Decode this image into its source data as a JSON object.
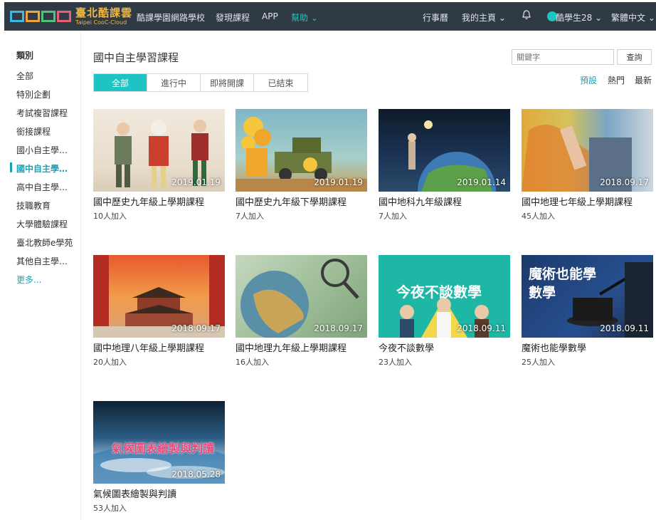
{
  "header": {
    "logo_cn": "臺北酷課雲",
    "logo_en": "Taipei CooC-Cloud",
    "nav": [
      {
        "label": "酷課學園網路學校"
      },
      {
        "label": "發現課程"
      },
      {
        "label": "APP"
      },
      {
        "label": "幫助 ⌄"
      }
    ],
    "right_nav": [
      {
        "label": "行事曆"
      },
      {
        "label": "我的主頁 ⌄"
      },
      {
        "label": "酷學生28 ⌄"
      },
      {
        "label": "繁體中文 ⌄"
      }
    ],
    "accent": "#1ec3c3",
    "bar_color": "#2f3a44"
  },
  "sidebar": {
    "heading": "類別",
    "items": [
      {
        "label": "全部"
      },
      {
        "label": "特別企劃"
      },
      {
        "label": "考試複習課程"
      },
      {
        "label": "銜接課程"
      },
      {
        "label": "國小自主學…"
      },
      {
        "label": "國中自主學…"
      },
      {
        "label": "高中自主學…"
      },
      {
        "label": "技職教育"
      },
      {
        "label": "大學體驗課程"
      },
      {
        "label": "臺北教師e學苑"
      },
      {
        "label": "其他自主學…"
      },
      {
        "label": "更多..."
      }
    ]
  },
  "main": {
    "title": "國中自主學習課程",
    "tabs": [
      {
        "label": "全部"
      },
      {
        "label": "進行中"
      },
      {
        "label": "即將開課"
      },
      {
        "label": "已結束"
      }
    ],
    "search": {
      "placeholder": "關鍵字",
      "button": "查詢"
    },
    "sort": [
      {
        "label": "預設"
      },
      {
        "label": "熱門"
      },
      {
        "label": "最新"
      }
    ],
    "courses": [
      {
        "title": "國中歷史九年級上學期課程",
        "date": "2019.01.19",
        "count": "10人加入"
      },
      {
        "title": "國中歷史九年級下學期課程",
        "date": "2019.01.19",
        "count": "7人加入"
      },
      {
        "title": "國中地科九年級課程",
        "date": "2019.01.14",
        "count": "7人加入"
      },
      {
        "title": "國中地理七年級上學期課程",
        "date": "2018.09.17",
        "count": "45人加入"
      },
      {
        "title": "國中地理八年級上學期課程",
        "date": "2018.09.17",
        "count": "20人加入"
      },
      {
        "title": "國中地理九年級上學期課程",
        "date": "2018.09.17",
        "count": "16人加入"
      },
      {
        "title": "今夜不談數學",
        "date": "2018.09.11",
        "count": "23人加入",
        "overlay": "今夜不談數學"
      },
      {
        "title": "魔術也能學數學",
        "date": "2018.09.11",
        "count": "25人加入",
        "overlay": "魔術也能學數學"
      },
      {
        "title": "氣候圖表繪製與判讀",
        "date": "2018.05.28",
        "count": "53人加入",
        "overlay": "氣候圖表繪製與判讀"
      }
    ]
  }
}
